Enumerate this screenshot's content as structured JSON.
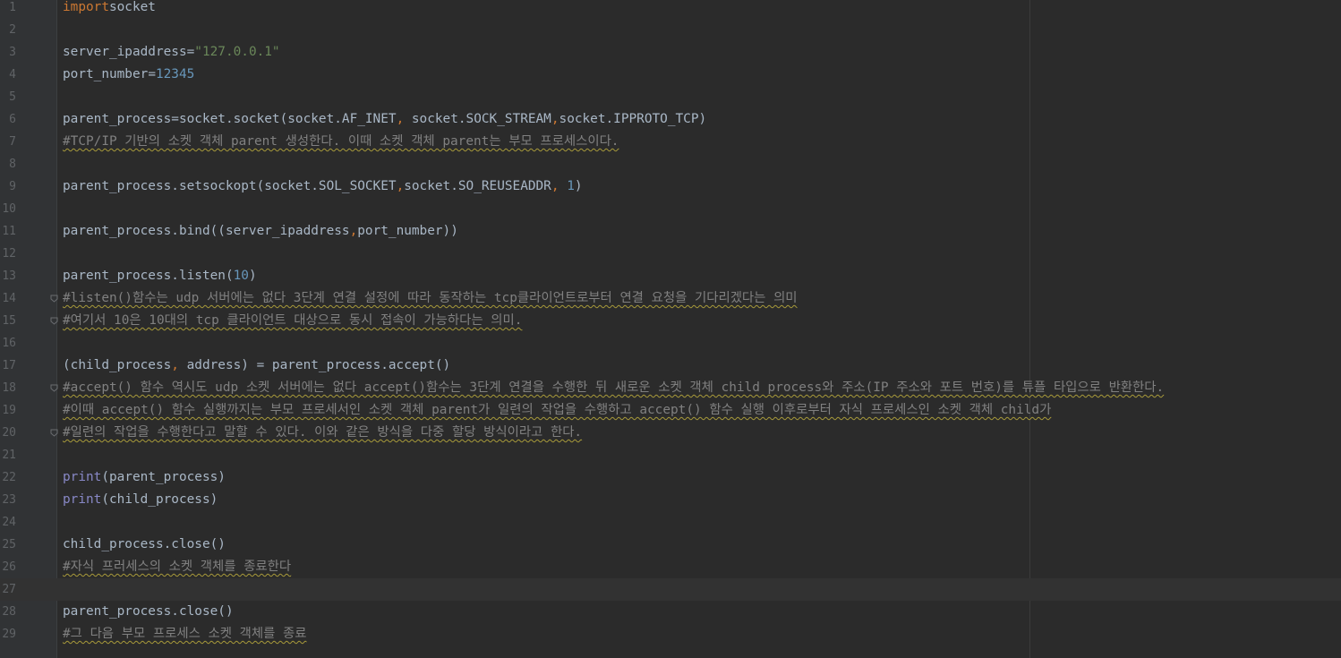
{
  "editor": {
    "language": "python",
    "current_line": 27,
    "colors": {
      "background": "#2b2b2b",
      "gutter": "#313335",
      "default_text": "#a9b7c6",
      "keyword": "#cc7832",
      "string": "#6a8759",
      "number": "#6897bb",
      "builtin": "#8888c6",
      "comment": "#808080",
      "line_number": "#606366",
      "current_line": "#323232"
    },
    "lines": [
      {
        "n": "1",
        "t": [
          [
            "kw",
            "import"
          ],
          [
            "",
            "socket"
          ]
        ]
      },
      {
        "n": "2",
        "t": []
      },
      {
        "n": "3",
        "t": [
          [
            "",
            "server_ipaddress"
          ],
          [
            "",
            "="
          ],
          [
            "str",
            "\"127.0.0.1\""
          ]
        ]
      },
      {
        "n": "4",
        "t": [
          [
            "",
            "port_number"
          ],
          [
            "",
            "="
          ],
          [
            "num",
            "12345"
          ]
        ]
      },
      {
        "n": "5",
        "t": []
      },
      {
        "n": "6",
        "t": [
          [
            "",
            "parent_process=socket.socket(socket.AF_INET"
          ],
          [
            "kw",
            ","
          ],
          [
            "",
            " socket.SOCK_STREAM"
          ],
          [
            "kw",
            ","
          ],
          [
            "",
            "socket.IPPROTO_TCP)"
          ]
        ]
      },
      {
        "n": "7",
        "t": [
          [
            "cm",
            "#TCP/IP 기반의 소켓 객체 parent 생성한다. 이때 소켓 객체 parent는 부모 프로세스이다."
          ]
        ]
      },
      {
        "n": "8",
        "t": []
      },
      {
        "n": "9",
        "t": [
          [
            "",
            "parent_process.setsockopt(socket.SOL_SOCKET"
          ],
          [
            "kw",
            ","
          ],
          [
            "",
            "socket.SO_REUSEADDR"
          ],
          [
            "kw",
            ","
          ],
          [
            "",
            " "
          ],
          [
            "num",
            "1"
          ],
          [
            "",
            ")"
          ]
        ]
      },
      {
        "n": "10",
        "t": []
      },
      {
        "n": "11",
        "t": [
          [
            "",
            "parent_process.bind((server_ipaddress"
          ],
          [
            "kw",
            ","
          ],
          [
            "",
            "port_number))"
          ]
        ]
      },
      {
        "n": "12",
        "t": []
      },
      {
        "n": "13",
        "t": [
          [
            "",
            "parent_process.listen("
          ],
          [
            "num",
            "10"
          ],
          [
            "",
            ")"
          ]
        ]
      },
      {
        "n": "14",
        "fold": true,
        "t": [
          [
            "cm",
            "#listen()함수는 udp 서버에는 없다 3단계 연결 설정에 따라 동작하는 tcp클라이언트로부터 연결 요청을 기다리겠다는 의미"
          ]
        ]
      },
      {
        "n": "15",
        "fold": true,
        "t": [
          [
            "cm",
            "#여기서 10은 10대의 tcp 클라이언트 대상으로 동시 접속이 가능하다는 의미."
          ]
        ]
      },
      {
        "n": "16",
        "t": []
      },
      {
        "n": "17",
        "t": [
          [
            "",
            "(child_process"
          ],
          [
            "kw",
            ","
          ],
          [
            "",
            " address) = parent_process.accept()"
          ]
        ]
      },
      {
        "n": "18",
        "fold": true,
        "t": [
          [
            "cm",
            "#accept() 함수 역시도 udp 소켓 서버에는 없다 accept()함수는 3단계 연결을 수행한 뒤 새로운 소켓 객체 child process와 주소(IP 주소와 포트 번호)를 튜플 타입으로 반환한다."
          ]
        ]
      },
      {
        "n": "19",
        "t": [
          [
            "cm",
            "#이때 accept() 함수 실행까지는 부모 프로세서인 소켓 객체 parent가 일련의 작업을 수행하고 accept() 함수 실행 이후로부터 자식 프로세스인 소켓 객체 child가"
          ]
        ]
      },
      {
        "n": "20",
        "fold": true,
        "t": [
          [
            "cm",
            "#일련의 작업을 수행한다고 말할 수 있다. 이와 같은 방식을 다중 할당 방식이라고 한다."
          ]
        ]
      },
      {
        "n": "21",
        "t": []
      },
      {
        "n": "22",
        "t": [
          [
            "bi",
            "print"
          ],
          [
            "",
            "(parent_process)"
          ]
        ]
      },
      {
        "n": "23",
        "t": [
          [
            "bi",
            "print"
          ],
          [
            "",
            "(child_process)"
          ]
        ]
      },
      {
        "n": "24",
        "t": []
      },
      {
        "n": "25",
        "t": [
          [
            "",
            "child_process.close()"
          ]
        ]
      },
      {
        "n": "26",
        "t": [
          [
            "cm",
            "#자식 프러세스의 소켓 객체를 종료한다"
          ]
        ]
      },
      {
        "n": "27",
        "t": []
      },
      {
        "n": "28",
        "t": [
          [
            "",
            "parent_process.close()"
          ]
        ]
      },
      {
        "n": "29",
        "t": [
          [
            "cm",
            "#그 다음 부모 프로세스 소켓 객체를 종료"
          ]
        ]
      }
    ]
  }
}
